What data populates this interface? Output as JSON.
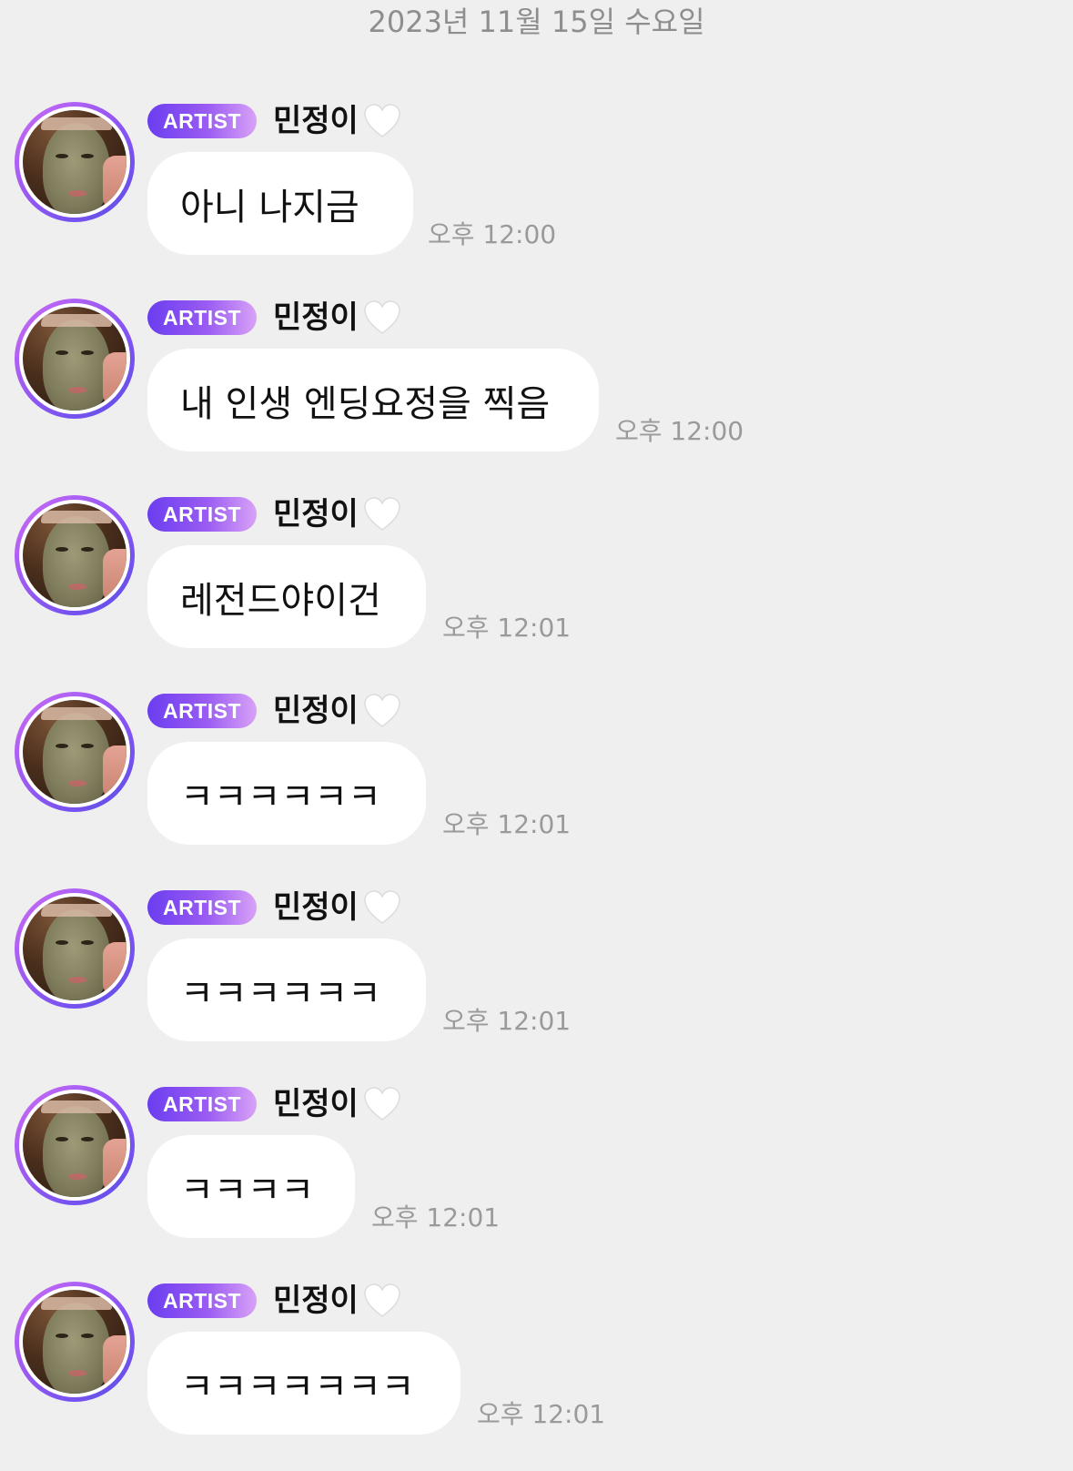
{
  "date_header": "2023년 11월 15일 수요일",
  "messages": [
    {
      "badge": "ARTIST",
      "sender": "민정이",
      "text": "아니 나지금",
      "time": "오후 12:00"
    },
    {
      "badge": "ARTIST",
      "sender": "민정이",
      "text": "내 인생 엔딩요정을 찍음",
      "time": "오후 12:00"
    },
    {
      "badge": "ARTIST",
      "sender": "민정이",
      "text": "레전드야이건",
      "time": "오후 12:01"
    },
    {
      "badge": "ARTIST",
      "sender": "민정이",
      "text": "ㅋㅋㅋㅋㅋㅋ",
      "time": "오후 12:01"
    },
    {
      "badge": "ARTIST",
      "sender": "민정이",
      "text": "ㅋㅋㅋㅋㅋㅋ",
      "time": "오후 12:01"
    },
    {
      "badge": "ARTIST",
      "sender": "민정이",
      "text": "ㅋㅋㅋㅋ",
      "time": "오후 12:01"
    },
    {
      "badge": "ARTIST",
      "sender": "민정이",
      "text": "ㅋㅋㅋㅋㅋㅋㅋ",
      "time": "오후 12:01"
    }
  ],
  "colors": {
    "background": "#efefef",
    "bubble": "#ffffff",
    "badge_start": "#6b3df0",
    "badge_end": "#d9a2f7",
    "timestamp": "#9a9a9a",
    "heart": "#ffffff"
  },
  "icons": {
    "badge_heart": "white-heart-icon"
  }
}
